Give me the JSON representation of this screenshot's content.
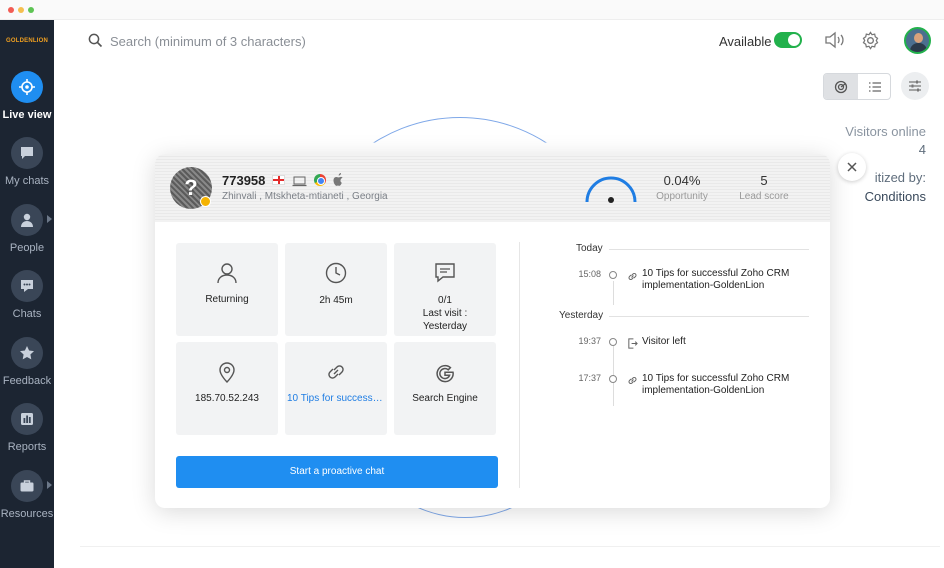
{
  "brand": "GOLDENLION",
  "sidebar": {
    "items": [
      {
        "label": "Live view",
        "icon": "crosshair-icon",
        "active": true
      },
      {
        "label": "My chats",
        "icon": "chat-bubble-icon"
      },
      {
        "label": "People",
        "icon": "person-icon",
        "has_submenu": true
      },
      {
        "label": "Chats",
        "icon": "chats-icon"
      },
      {
        "label": "Feedback",
        "icon": "star-icon"
      },
      {
        "label": "Reports",
        "icon": "bar-chart-icon"
      },
      {
        "label": "Resources",
        "icon": "briefcase-icon",
        "has_submenu": true
      }
    ]
  },
  "search": {
    "placeholder": "Search (minimum of 3 characters)"
  },
  "topbar": {
    "availability_label": "Available",
    "availability_on": true
  },
  "panel": {
    "visitors_online_label": "Visitors online",
    "visitors_online_count": "4",
    "prioritized_label": "itized by:",
    "prioritized_value": "Conditions"
  },
  "visitor": {
    "id": "773958",
    "location": "Zhinvali , Mtskheta-mtianeti , Georgia",
    "opportunity_value": "0.04%",
    "opportunity_label": "Opportunity",
    "lead_score_value": "5",
    "lead_score_label": "Lead score",
    "tiles": [
      {
        "icon": "user-icon",
        "text": "Returning"
      },
      {
        "icon": "clock-icon",
        "text": "2h 45m"
      },
      {
        "icon": "message-icon",
        "lines": [
          "0/1",
          "Last visit :",
          "Yesterday"
        ]
      },
      {
        "icon": "location-pin-icon",
        "text": "185.70.52.243"
      },
      {
        "icon": "link-icon",
        "text": "10 Tips for successful Zoho CRM implementation-GoldenLion",
        "is_link": true
      },
      {
        "icon": "google-icon",
        "text": "Search Engine"
      }
    ],
    "proactive_button": "Start a proactive chat",
    "timeline": {
      "today_label": "Today",
      "yesterday_label": "Yesterday",
      "entries": [
        {
          "time": "15:08",
          "icon": "link-icon",
          "lines": [
            "10 Tips for successful Zoho CRM",
            "implementation-GoldenLion"
          ]
        },
        {
          "time": "19:37",
          "icon": "exit-icon",
          "lines": [
            "Visitor left"
          ]
        },
        {
          "time": "17:37",
          "icon": "link-icon",
          "lines": [
            "10 Tips for successful Zoho CRM",
            "implementation-GoldenLion"
          ]
        }
      ]
    }
  },
  "colors": {
    "accent": "#1f8ef1",
    "sidebar_bg": "#1c2532",
    "available_green": "#22b14c",
    "status_yellow": "#f5b301"
  }
}
